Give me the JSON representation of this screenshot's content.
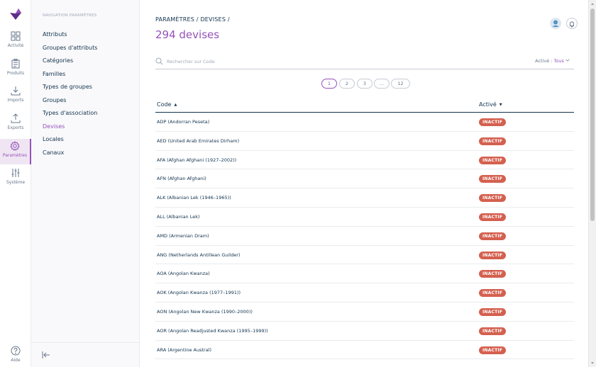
{
  "rail": {
    "items": [
      {
        "label": "Activité",
        "icon": "dashboard-icon"
      },
      {
        "label": "Produits",
        "icon": "products-icon"
      },
      {
        "label": "Imports",
        "icon": "import-icon"
      },
      {
        "label": "Exports",
        "icon": "export-icon"
      },
      {
        "label": "Paramètres",
        "icon": "settings-icon",
        "active": true
      },
      {
        "label": "Système",
        "icon": "system-icon"
      }
    ],
    "help_label": "Aide",
    "accent_color": "#9452ba"
  },
  "subnav": {
    "title": "NAVIGATION PARAMÈTRES",
    "items": [
      {
        "label": "Attributs"
      },
      {
        "label": "Groupes d'attributs"
      },
      {
        "label": "Catégories"
      },
      {
        "label": "Familles"
      },
      {
        "label": "Types de groupes"
      },
      {
        "label": "Groupes"
      },
      {
        "label": "Types d'association"
      },
      {
        "label": "Devises",
        "active": true
      },
      {
        "label": "Locales"
      },
      {
        "label": "Canaux"
      }
    ]
  },
  "header": {
    "breadcrumb_1": "PARAMÈTRES",
    "breadcrumb_sep_1": "/",
    "breadcrumb_2": "DEVISES",
    "breadcrumb_sep_2": "/",
    "title": "294 devises"
  },
  "search": {
    "placeholder": "Rechercher sur Code",
    "value": ""
  },
  "filter": {
    "label": "Activé :",
    "value": "Tous"
  },
  "pagination": {
    "pages": [
      "1",
      "2",
      "3",
      "...",
      "12"
    ],
    "current": "1"
  },
  "table": {
    "columns": [
      "Code",
      "Activé"
    ],
    "rows": [
      {
        "code": "ADP (Andorran Peseta)",
        "status": "INACTIF"
      },
      {
        "code": "AED (United Arab Emirates Dirham)",
        "status": "INACTIF"
      },
      {
        "code": "AFA (Afghan Afghani (1927–2002))",
        "status": "INACTIF"
      },
      {
        "code": "AFN (Afghan Afghani)",
        "status": "INACTIF"
      },
      {
        "code": "ALK (Albanian Lek (1946–1965))",
        "status": "INACTIF"
      },
      {
        "code": "ALL (Albanian Lek)",
        "status": "INACTIF"
      },
      {
        "code": "AMD (Armenian Dram)",
        "status": "INACTIF"
      },
      {
        "code": "ANG (Netherlands Antillean Guilder)",
        "status": "INACTIF"
      },
      {
        "code": "AOA (Angolan Kwanza)",
        "status": "INACTIF"
      },
      {
        "code": "AOK (Angolan Kwanza (1977–1991))",
        "status": "INACTIF"
      },
      {
        "code": "AON (Angolan New Kwanza (1990–2000))",
        "status": "INACTIF"
      },
      {
        "code": "AOR (Angolan Readjusted Kwanza (1995–1999))",
        "status": "INACTIF"
      },
      {
        "code": "ARA (Argentine Austral)",
        "status": "INACTIF"
      }
    ],
    "badge_color": "#d4604f"
  }
}
